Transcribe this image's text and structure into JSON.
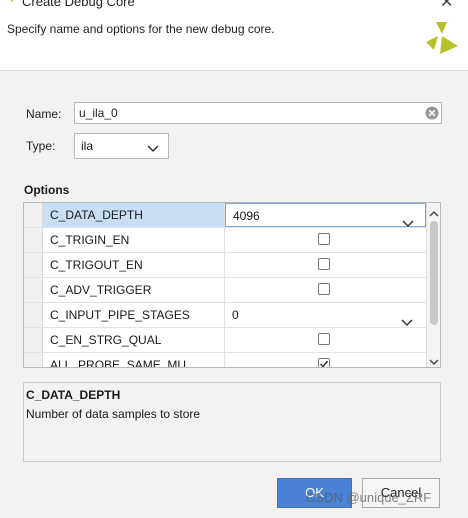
{
  "window": {
    "title": "Create Debug Core"
  },
  "header": {
    "instructions": "Specify name and options for the new debug core."
  },
  "form": {
    "name_label": "Name:",
    "name_value": "u_ila_0",
    "type_label": "Type:",
    "type_value": "ila"
  },
  "options": {
    "title": "Options",
    "rows": [
      {
        "name": "C_DATA_DEPTH",
        "kind": "select",
        "value": "4096",
        "selected": true
      },
      {
        "name": "C_TRIGIN_EN",
        "kind": "checkbox",
        "checked": false
      },
      {
        "name": "C_TRIGOUT_EN",
        "kind": "checkbox",
        "checked": false
      },
      {
        "name": "C_ADV_TRIGGER",
        "kind": "checkbox",
        "checked": false
      },
      {
        "name": "C_INPUT_PIPE_STAGES",
        "kind": "select",
        "value": "0"
      },
      {
        "name": "C_EN_STRG_QUAL",
        "kind": "checkbox",
        "checked": false
      },
      {
        "name": "ALL_PROBE_SAME_MU",
        "kind": "checkbox",
        "checked": true
      }
    ]
  },
  "description": {
    "title": "C_DATA_DEPTH",
    "text": "Number of data samples to store"
  },
  "buttons": {
    "ok": "OK",
    "cancel": "Cancel"
  },
  "watermark": "CSDN @unique_ZRF",
  "colors": {
    "accent": "#4a83d6",
    "selection": "#c9ddf5",
    "logo": "#b9c12a"
  }
}
